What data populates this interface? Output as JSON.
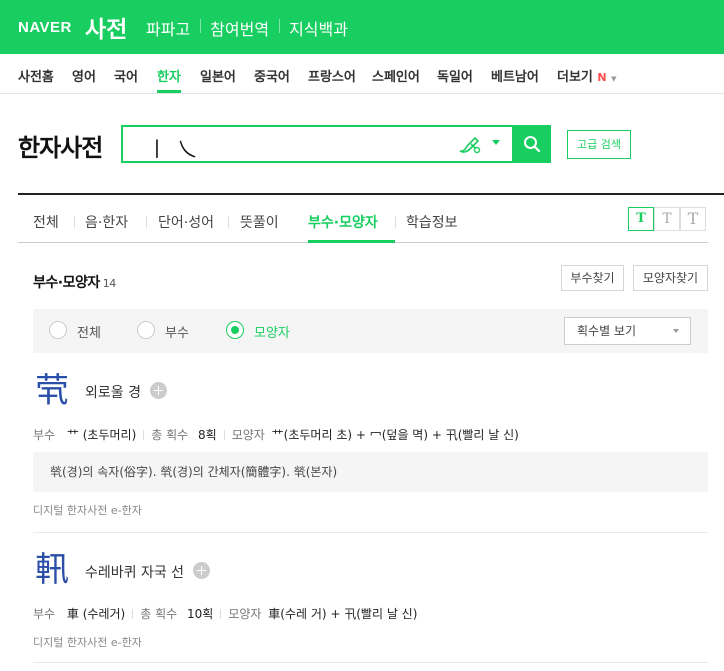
{
  "header": {
    "logo": "NAVER",
    "service": "사전",
    "links": [
      "파파고",
      "참여번역",
      "지식백과"
    ]
  },
  "dict_nav": {
    "items": [
      "사전홈",
      "영어",
      "국어",
      "한자",
      "일본어",
      "중국어",
      "프랑스어",
      "스페인어",
      "독일어",
      "베트남어",
      "더보기"
    ],
    "active": "한자",
    "more_badge": "N"
  },
  "search": {
    "page_title": "한자사전",
    "query": "丨乀",
    "advanced_label": "고급 검색",
    "handwriting_icon": "brush-icon",
    "submit_icon": "search-icon"
  },
  "tabs": {
    "items": [
      "전체",
      "음·한자",
      "단어·성어",
      "뜻풀이",
      "부수·모양자",
      "학습정보"
    ],
    "active": "부수·모양자",
    "font_sizes": [
      "T",
      "T",
      "T"
    ]
  },
  "results": {
    "title": "부수·모양자",
    "count": "14",
    "radical_search": "부수찾기",
    "shape_search": "모양자찾기",
    "filters": [
      "전체",
      "부수",
      "모양자"
    ],
    "selected_filter": "모양자",
    "sort_label": "획수별 보기"
  },
  "entries": [
    {
      "char": "茕",
      "meaning": "외로울 경",
      "radical_label": "부수",
      "radical": "艹 (초두머리)",
      "strokes_label": "총 획수",
      "strokes": "8획",
      "shape_label": "모양자",
      "shape": "艹(초두머리 초) + 冖(덮을 멱) + 卂(빨리 날 신)",
      "note": "㷀(경)의 속자(俗字). 㷀(경)의 간체자(簡體字). 㷀(본자)",
      "source": "디지털 한자사전 e-한자"
    },
    {
      "char": "軐",
      "meaning": "수레바퀴 자국 선",
      "radical_label": "부수",
      "radical": "車 (수레거)",
      "strokes_label": "총 획수",
      "strokes": "10획",
      "shape_label": "모양자",
      "shape": "車(수레 거) + 卂(빨리 날 신)",
      "source": "디지털 한자사전 e-한자"
    }
  ],
  "colors": {
    "brand_green": "#19ce60",
    "hanja_blue": "#2b4fa8"
  }
}
